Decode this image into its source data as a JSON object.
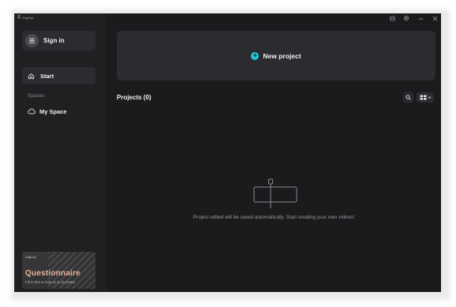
{
  "app": {
    "logo_text": "CapCut"
  },
  "sidebar": {
    "signin_label": "Sign in",
    "nav": [
      {
        "label": "Start",
        "icon": "home-icon"
      }
    ],
    "spaces_heading": "Spaces",
    "spaces": [
      {
        "label": "My Space",
        "icon": "cloud-icon"
      }
    ],
    "promo": {
      "brand": "CapCut",
      "title": "Questionnaire",
      "subtitle": "Fill in this to help us to do better"
    }
  },
  "main": {
    "new_project_label": "New project",
    "projects_title": "Projects  (0)",
    "empty_message": "Project edited will be saved automatically. Start creating your own videos!"
  },
  "colors": {
    "accent": "#22c6d6",
    "window_bg": "#1b1b1d",
    "sidebar_bg": "#202023",
    "card_bg": "#2c2c30",
    "promo_title": "#e8b49a"
  }
}
